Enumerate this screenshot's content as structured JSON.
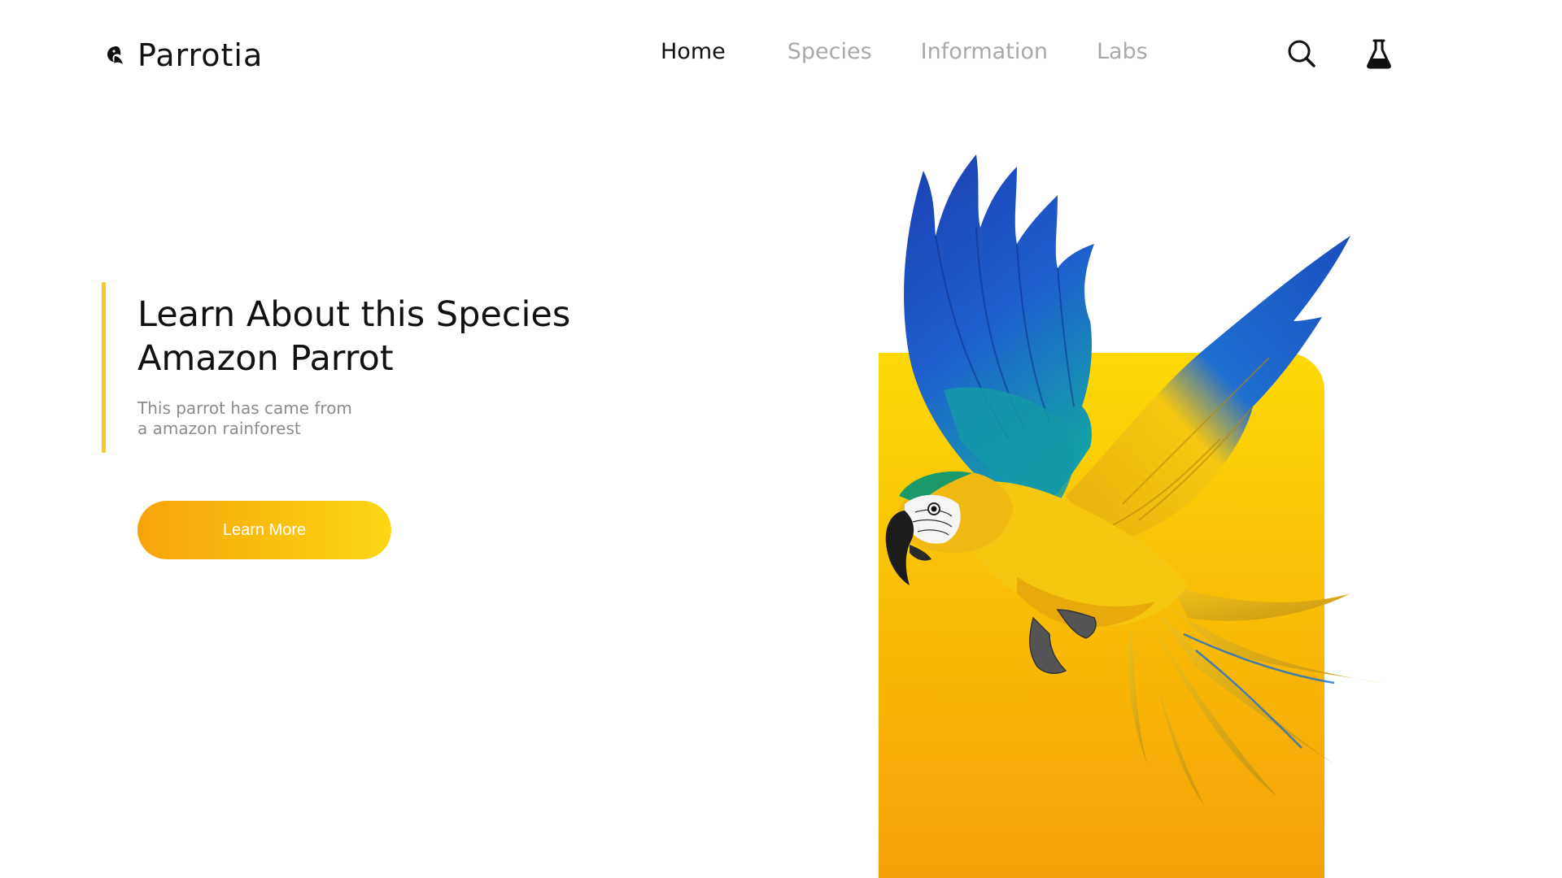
{
  "header": {
    "brand": "Parrotia",
    "logo_icon": "parrot-logo-icon",
    "nav": [
      {
        "label": "Home",
        "active": true
      },
      {
        "label": "Species",
        "active": false
      },
      {
        "label": "Information",
        "active": false
      },
      {
        "label": "Labs",
        "active": false
      }
    ],
    "icons": [
      "search-icon",
      "flask-icon"
    ]
  },
  "hero": {
    "title": "Learn About this Species",
    "heading": "Amazon Parrot",
    "description_line1": "This parrot has came from",
    "description_line2": "a amazon rainforest",
    "cta_label": "Learn More",
    "image": "macaw-parrot-image"
  },
  "colors": {
    "accent": "#f8c81b",
    "gradient_start": "#f5a40b",
    "gradient_end": "#fcd714",
    "parrot_blue": "#1f4fbf",
    "parrot_teal": "#1aa3a8",
    "parrot_yellow": "#f6c710"
  }
}
